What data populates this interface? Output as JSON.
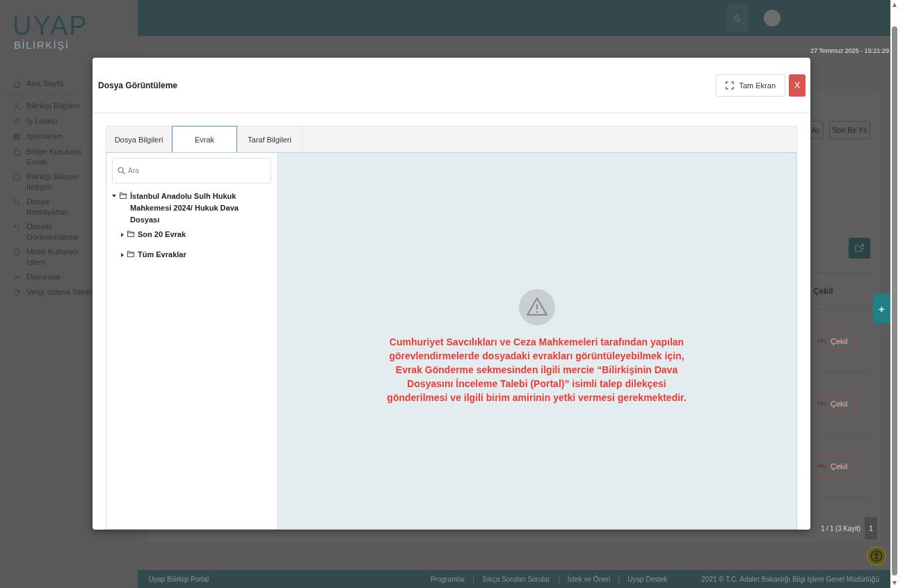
{
  "logo": {
    "title": "UYAP",
    "subtitle": "BİLİRKİŞİ"
  },
  "sidebar": {
    "items": [
      {
        "label": "Ana Sayfa"
      },
      {
        "label": "Bilirkişi Bilgileri"
      },
      {
        "label": "İş Listesi"
      },
      {
        "label": "İşlemlerim"
      },
      {
        "label": "Bölge Kuruluna Evrak"
      },
      {
        "label": "Bilirkişi Bilişsel İletişim"
      },
      {
        "label": "Dosya Reddiyatları"
      },
      {
        "label": "Önceki Görevlendirme"
      },
      {
        "label": "Mobil Kullanıcı İşlem"
      },
      {
        "label": "Duyurular"
      },
      {
        "label": "Vergi İstisna Talebi"
      }
    ]
  },
  "header": {
    "date": "27 Temmuz 2025 - 15:21:29"
  },
  "panel": {
    "period_buttons": [
      "Ay",
      "Son Bir Yıl"
    ],
    "column": "Çekil",
    "rows": [
      {
        "action": "Çekil"
      },
      {
        "action": "Çekil"
      },
      {
        "action": "Çekil"
      }
    ],
    "summary": "1 / 1 (3 Kayıt)",
    "page": "1"
  },
  "side_tab": "+",
  "footer": {
    "title": "Uyap Bilirkişi Portal",
    "links": [
      "Programlar",
      "Sıkça Sorulan Sorular",
      "İstek ve Öneri",
      "Uyap Destek"
    ],
    "copyright": "2021 © T.C. Adalet Bakanlığı Bilgi İşlem Genel Müdürlüğü"
  },
  "modal": {
    "title": "Dosya Görüntüleme",
    "fullscreen_button": "Tam Ekran",
    "close_button": "X",
    "tabs": [
      {
        "label": "Dosya Bilgileri",
        "selected": false
      },
      {
        "label": "Evrak",
        "selected": true
      },
      {
        "label": "Taraf Bilgileri",
        "selected": false
      }
    ],
    "search": {
      "placeholder": "Ara"
    },
    "tree": [
      {
        "label": "İstanbul Anadolu Sulh Hukuk Mahkemesi 2024/ Hukuk Dava Dosyası",
        "expanded": true,
        "children": [
          {
            "label": "Son 20 Evrak",
            "expanded": false
          },
          {
            "label": "Tüm Evraklar",
            "expanded": false
          }
        ]
      }
    ],
    "message": "Cumhuriyet Savcılıkları ve Ceza Mahkemeleri tarafından yapılan görevlendirmelerde dosyadaki evrakları görüntüleyebilmek için, Evrak Gönderme sekmesinden ilgili mercie “Bilirkişinin Dava Dosyasını İnceleme Talebi (Portal)” isimli talep dilekçesi gönderilmesi ve ilgili birim amirinin yetki vermesi gerekmektedir."
  }
}
